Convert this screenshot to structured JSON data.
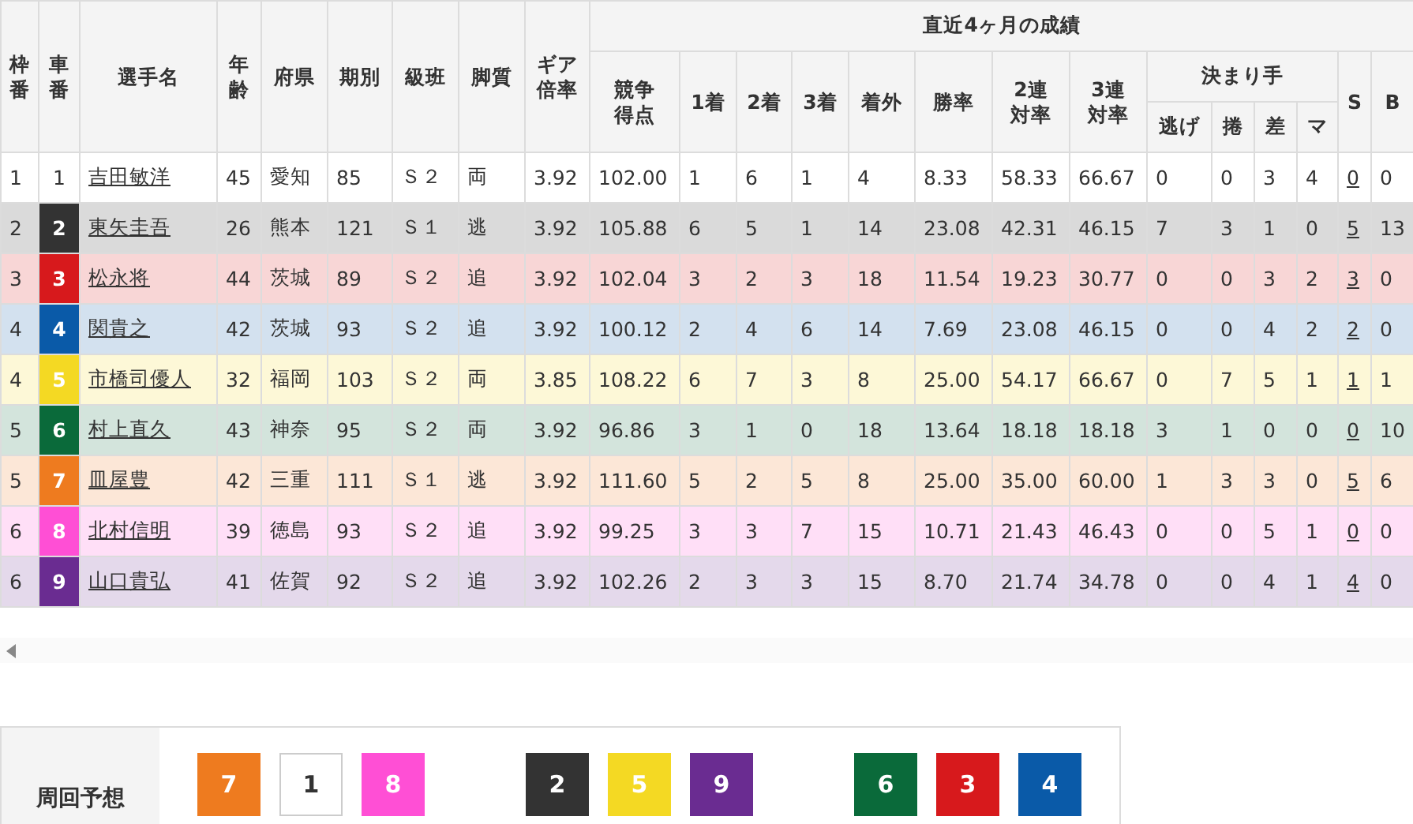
{
  "table": {
    "left_columns": [
      "枠番",
      "車番",
      "選手名",
      "年齢",
      "府県",
      "期別",
      "級班",
      "脚質",
      "ギア倍率"
    ],
    "group_title": "直近4ヶ月の成績",
    "group_columns": [
      "競争得点",
      "1着",
      "2着",
      "3着",
      "着外",
      "勝率",
      "2連対率",
      "3連対率"
    ],
    "kimarite_title": "決まり手",
    "kimarite_columns": [
      "逃げ",
      "捲",
      "差",
      "マ"
    ],
    "right_columns": [
      "S",
      "B"
    ],
    "rows": [
      {
        "frame": "1",
        "car": "1",
        "color": "#ffffff",
        "name": "吉田敏洋",
        "values": [
          "45",
          "愛知",
          "85",
          "Ｓ２",
          "両",
          "3.92",
          "102.00",
          "1",
          "6",
          "1",
          "4",
          "8.33",
          "58.33",
          "66.67",
          "0",
          "0",
          "3",
          "4"
        ],
        "s": "0",
        "b": "0"
      },
      {
        "frame": "2",
        "car": "2",
        "color": "#333333",
        "name": "東矢圭吾",
        "values": [
          "26",
          "熊本",
          "121",
          "Ｓ１",
          "逃",
          "3.92",
          "105.88",
          "6",
          "5",
          "1",
          "14",
          "23.08",
          "42.31",
          "46.15",
          "7",
          "3",
          "1",
          "0"
        ],
        "s": "5",
        "b": "13"
      },
      {
        "frame": "3",
        "car": "3",
        "color": "#d7191c",
        "name": "松永将",
        "values": [
          "44",
          "茨城",
          "89",
          "Ｓ２",
          "追",
          "3.92",
          "102.04",
          "3",
          "2",
          "3",
          "18",
          "11.54",
          "19.23",
          "30.77",
          "0",
          "0",
          "3",
          "2"
        ],
        "s": "3",
        "b": "0"
      },
      {
        "frame": "4",
        "car": "4",
        "color": "#0a5aa8",
        "name": "関貴之",
        "values": [
          "42",
          "茨城",
          "93",
          "Ｓ２",
          "追",
          "3.92",
          "100.12",
          "2",
          "4",
          "6",
          "14",
          "7.69",
          "23.08",
          "46.15",
          "0",
          "0",
          "4",
          "2"
        ],
        "s": "2",
        "b": "0"
      },
      {
        "frame": "4",
        "car": "5",
        "color": "#f4d923",
        "name": "市橋司優人",
        "values": [
          "32",
          "福岡",
          "103",
          "Ｓ２",
          "両",
          "3.85",
          "108.22",
          "6",
          "7",
          "3",
          "8",
          "25.00",
          "54.17",
          "66.67",
          "0",
          "7",
          "5",
          "1"
        ],
        "s": "1",
        "b": "1"
      },
      {
        "frame": "5",
        "car": "6",
        "color": "#0a6a3a",
        "name": "村上直久",
        "values": [
          "43",
          "神奈",
          "95",
          "Ｓ２",
          "両",
          "3.92",
          "96.86",
          "3",
          "1",
          "0",
          "18",
          "13.64",
          "18.18",
          "18.18",
          "3",
          "1",
          "0",
          "0"
        ],
        "s": "0",
        "b": "10"
      },
      {
        "frame": "5",
        "car": "7",
        "color": "#ee7b1f",
        "name": "皿屋豊",
        "values": [
          "42",
          "三重",
          "111",
          "Ｓ１",
          "逃",
          "3.92",
          "111.60",
          "5",
          "2",
          "5",
          "8",
          "25.00",
          "35.00",
          "60.00",
          "1",
          "3",
          "3",
          "0"
        ],
        "s": "5",
        "b": "6"
      },
      {
        "frame": "6",
        "car": "8",
        "color": "#ff4fd5",
        "name": "北村信明",
        "values": [
          "39",
          "徳島",
          "93",
          "Ｓ２",
          "追",
          "3.92",
          "99.25",
          "3",
          "3",
          "7",
          "15",
          "10.71",
          "21.43",
          "46.43",
          "0",
          "0",
          "5",
          "1"
        ],
        "s": "0",
        "b": "0"
      },
      {
        "frame": "6",
        "car": "9",
        "color": "#6a2c91",
        "name": "山口貴弘",
        "values": [
          "41",
          "佐賀",
          "92",
          "Ｓ２",
          "追",
          "3.92",
          "102.26",
          "2",
          "3",
          "3",
          "15",
          "8.70",
          "21.74",
          "34.78",
          "0",
          "0",
          "4",
          "1"
        ],
        "s": "4",
        "b": "0"
      }
    ]
  },
  "prediction": {
    "title": "周回予想",
    "groups": [
      [
        {
          "label": "7",
          "color": "#ee7b1f"
        },
        {
          "label": "1",
          "color": "#ffffff"
        },
        {
          "label": "8",
          "color": "#ff4fd5"
        }
      ],
      [
        {
          "label": "2",
          "color": "#333333"
        },
        {
          "label": "5",
          "color": "#f4d923"
        },
        {
          "label": "9",
          "color": "#6a2c91"
        }
      ],
      [
        {
          "label": "6",
          "color": "#0a6a3a"
        },
        {
          "label": "3",
          "color": "#d7191c"
        },
        {
          "label": "4",
          "color": "#0a5aa8"
        }
      ]
    ]
  }
}
